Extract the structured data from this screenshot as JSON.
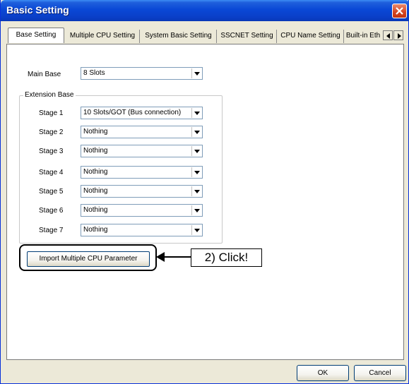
{
  "window": {
    "title": "Basic Setting"
  },
  "tabs": [
    {
      "label": "Base Setting",
      "active": true
    },
    {
      "label": "Multiple CPU Setting",
      "active": false
    },
    {
      "label": "System Basic Setting",
      "active": false
    },
    {
      "label": "SSCNET Setting",
      "active": false
    },
    {
      "label": "CPU Name Setting",
      "active": false
    },
    {
      "label": "Built-in Eth",
      "active": false
    }
  ],
  "main_base": {
    "label": "Main Base",
    "value": "8 Slots"
  },
  "extension_base": {
    "title": "Extension Base",
    "stages": [
      {
        "label": "Stage 1",
        "value": "10 Slots/GOT (Bus connection)"
      },
      {
        "label": "Stage 2",
        "value": "Nothing"
      },
      {
        "label": "Stage 3",
        "value": "Nothing"
      },
      {
        "label": "Stage 4",
        "value": "Nothing"
      },
      {
        "label": "Stage 5",
        "value": "Nothing"
      },
      {
        "label": "Stage 6",
        "value": "Nothing"
      },
      {
        "label": "Stage 7",
        "value": "Nothing"
      }
    ]
  },
  "import_button": {
    "label": "Import Multiple CPU Parameter"
  },
  "callout": {
    "text": "2) Click!"
  },
  "footer": {
    "ok_label": "OK",
    "cancel_label": "Cancel"
  },
  "colors": {
    "titlebar": "#0a48d6",
    "window_bg": "#ece9d8",
    "combo_border": "#7f9db9"
  }
}
